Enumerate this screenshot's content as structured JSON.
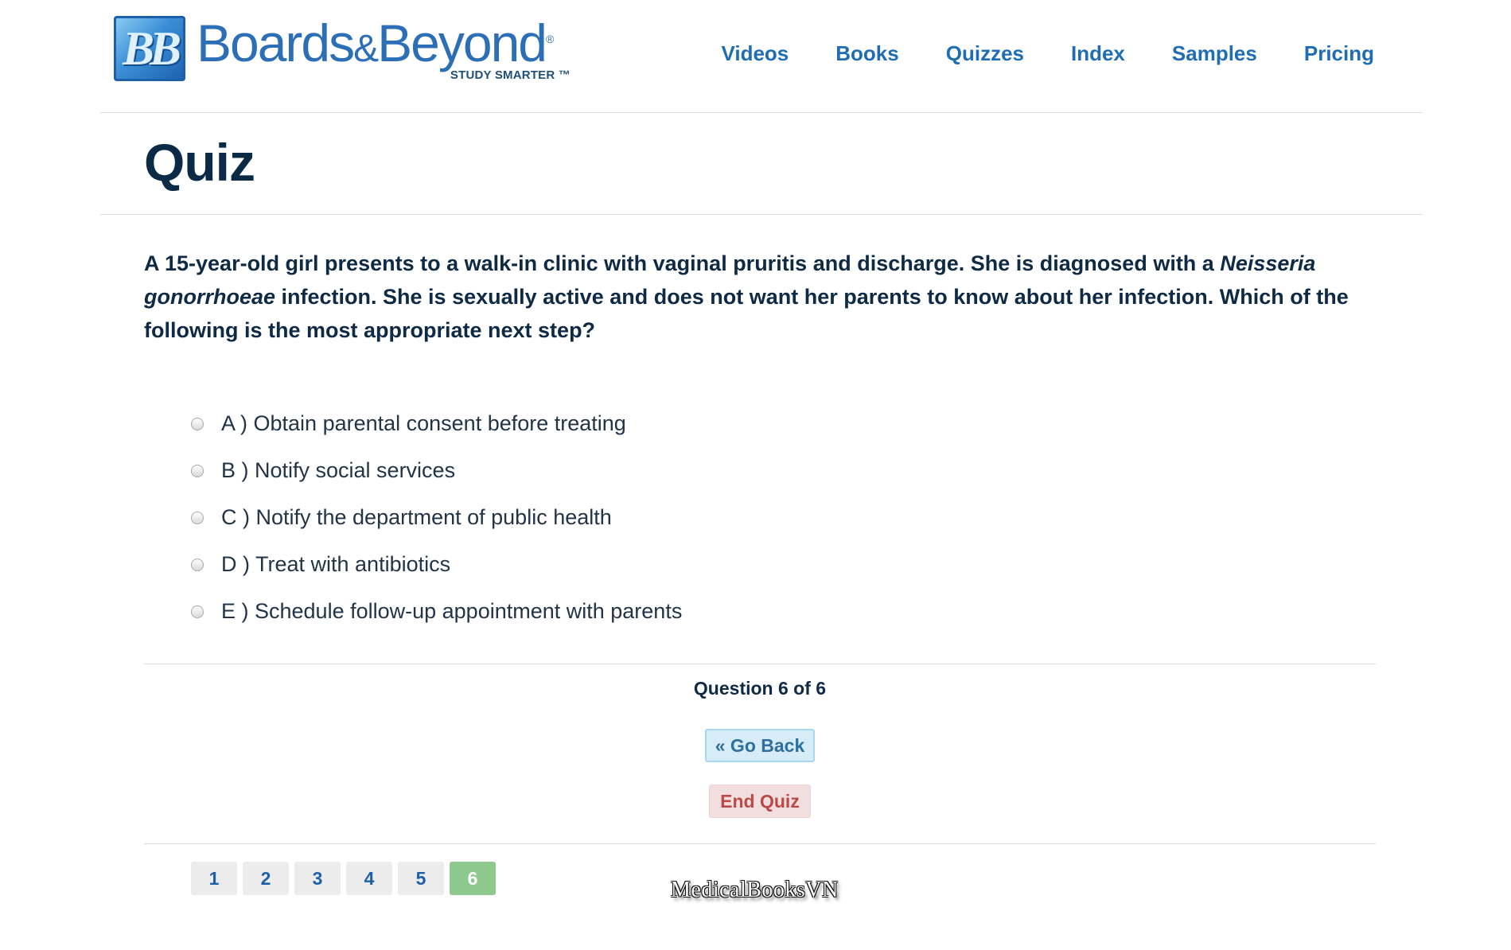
{
  "brand": {
    "mark": "BB",
    "name_part1": "Boards",
    "name_amp": "&",
    "name_part2": "Beyond",
    "registered": "®",
    "tagline": "STUDY SMARTER ™"
  },
  "nav": {
    "items": [
      {
        "label": "Videos"
      },
      {
        "label": "Books"
      },
      {
        "label": "Quizzes"
      },
      {
        "label": "Index"
      },
      {
        "label": "Samples"
      },
      {
        "label": "Pricing"
      }
    ]
  },
  "page": {
    "title": "Quiz"
  },
  "question": {
    "text_part1": "A 15-year-old girl presents to a walk-in clinic with vaginal pruritis and discharge. She is diagnosed with a ",
    "organism": "Neisseria gonorrhoeae",
    "text_part2": " infection. She is sexually active and does not want her parents to know about her infection. Which of the following is the most appropriate next step?"
  },
  "choices": [
    {
      "label": "A ) Obtain parental consent before treating"
    },
    {
      "label": "B ) Notify social services"
    },
    {
      "label": "C ) Notify the department of public health"
    },
    {
      "label": "D ) Treat with antibiotics"
    },
    {
      "label": "E ) Schedule follow-up appointment with parents"
    }
  ],
  "progress": {
    "text": "Question 6 of 6",
    "current": 6,
    "total": 6
  },
  "buttons": {
    "go_back": "« Go Back",
    "end_quiz": "End Quiz"
  },
  "pager": {
    "pages": [
      {
        "label": "1"
      },
      {
        "label": "2"
      },
      {
        "label": "3"
      },
      {
        "label": "4"
      },
      {
        "label": "5"
      },
      {
        "label": "6"
      }
    ]
  },
  "watermark": "MedicalBooksVN",
  "colors": {
    "nav_link": "#1e6db5",
    "heading": "#0b2a45",
    "back_button_bg": "#d6edf7",
    "end_button_bg": "#f2dede",
    "end_button_text": "#b94a48",
    "current_page_bg": "#8dc98d"
  }
}
